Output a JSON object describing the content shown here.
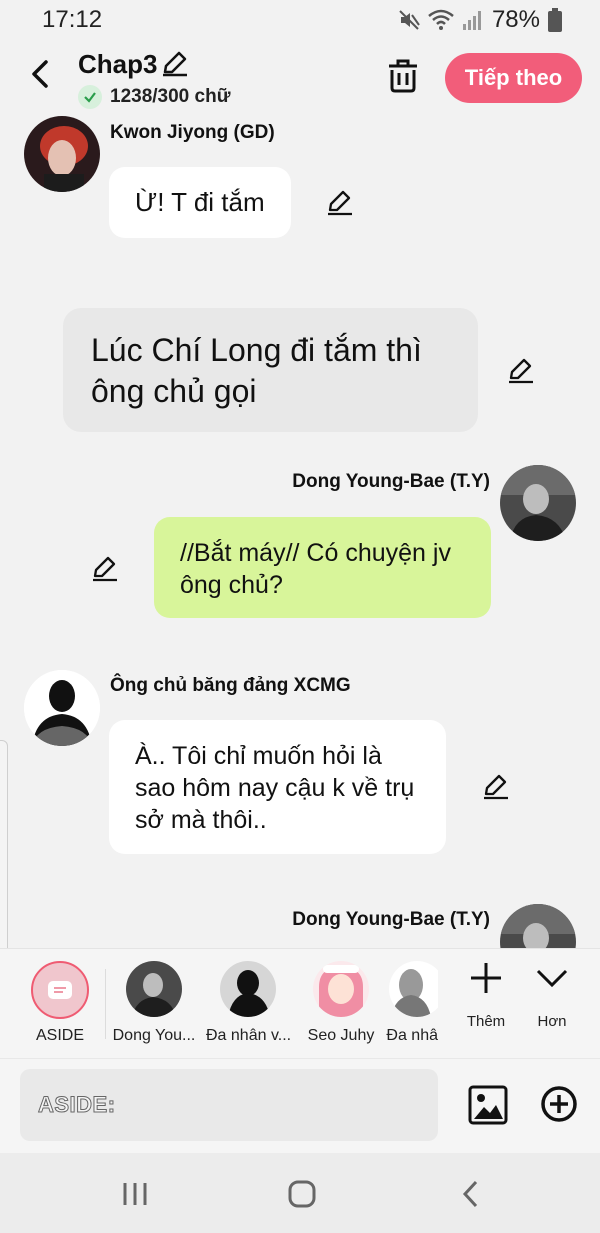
{
  "status_bar": {
    "time": "17:12",
    "battery": "78%"
  },
  "header": {
    "title": "Chap3",
    "word_count": "1238/300 chữ",
    "next_button": "Tiếp theo"
  },
  "messages": [
    {
      "type": "character",
      "sender": "Kwon Jiyong (GD)",
      "text": "Ừ! T đi tắm",
      "side": "left"
    },
    {
      "type": "narration",
      "text": "Lúc Chí Long đi tắm thì ông chủ gọi"
    },
    {
      "type": "character",
      "sender": "Dong Young-Bae (T.Y)",
      "text": "//Bắt máy// Có chuyện jv ông chủ?",
      "side": "right"
    },
    {
      "type": "character",
      "sender": "Ông chủ băng đảng XCMG",
      "text": "À.. Tôi chỉ muốn hỏi là sao hôm nay cậu k về trụ sở mà thôi..",
      "side": "left"
    },
    {
      "type": "character",
      "sender": "Dong Young-Bae (T.Y)",
      "text": "",
      "side": "right"
    }
  ],
  "character_bar": {
    "aside_label": "ASIDE",
    "characters": [
      {
        "name": "Dong You..."
      },
      {
        "name": "Đa nhân v..."
      },
      {
        "name": "Seo Juhy"
      },
      {
        "name": "Đa nhâ"
      }
    ],
    "add_label": "Thêm",
    "more_label": "Hơn"
  },
  "input": {
    "placeholder": "ASIDE:"
  },
  "colors": {
    "accent": "#f25d7a",
    "right_bubble": "#d8f59a",
    "narration_bubble": "#e8e8e8",
    "background": "#f2f2f2"
  }
}
